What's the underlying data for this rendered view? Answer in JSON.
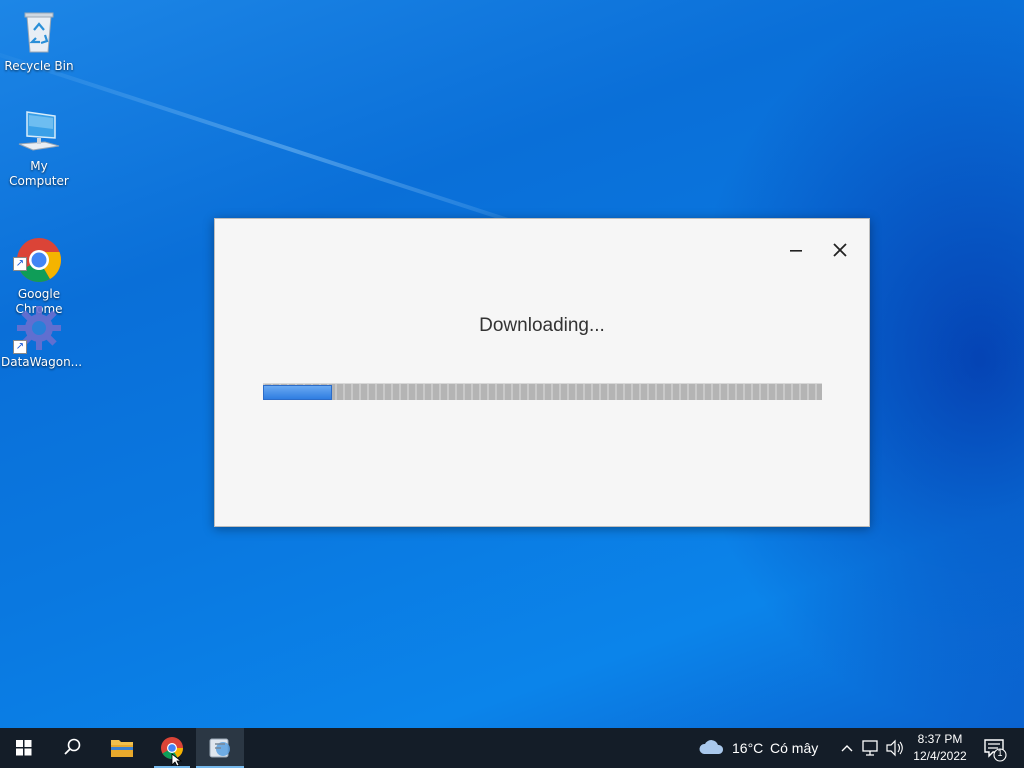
{
  "desktop": {
    "icons": [
      {
        "label": "Recycle Bin"
      },
      {
        "label": "My Computer"
      },
      {
        "label": "Google\nChrome"
      },
      {
        "label": "DataWagon..."
      }
    ]
  },
  "dialog": {
    "title": "Downloading...",
    "progress_fraction": 0.12,
    "accent": "#2f7de1"
  },
  "taskbar": {
    "icons": [
      "windows-start-icon",
      "search-icon",
      "file-explorer-icon",
      "chrome-icon",
      "installer-icon"
    ],
    "weather": {
      "temperature": "16°C",
      "condition": "Có mây"
    },
    "clock": {
      "time": "8:37 PM",
      "date": "12/4/2022"
    },
    "notification_count": "1"
  }
}
